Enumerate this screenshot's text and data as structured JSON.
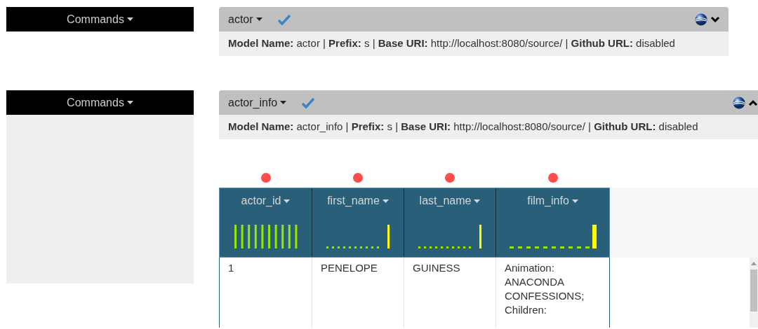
{
  "models": [
    {
      "commands_label": "Commands",
      "name": "actor",
      "expanded": false,
      "info": "**Model Name:** actor | **Prefix:** s | **Base URI:** http://localhost:8080/source/ | **Github URL:** disabled"
    },
    {
      "commands_label": "Commands",
      "name": "actor_info",
      "expanded": true,
      "info": "**Model Name:** actor_info | **Prefix:** s | **Base URI:** http://localhost:8080/source/ | **Github URL:** disabled",
      "table": {
        "columns": [
          {
            "name": "actor_id",
            "kind": "uniform"
          },
          {
            "name": "first_name",
            "kind": "dotted"
          },
          {
            "name": "last_name",
            "kind": "dotted"
          },
          {
            "name": "film_info",
            "kind": "dashed"
          }
        ],
        "rows": [
          [
            "1",
            "PENELOPE",
            "GUINESS",
            "Animation: ANACONDA CONFESSIONS; Children:"
          ]
        ]
      }
    }
  ]
}
